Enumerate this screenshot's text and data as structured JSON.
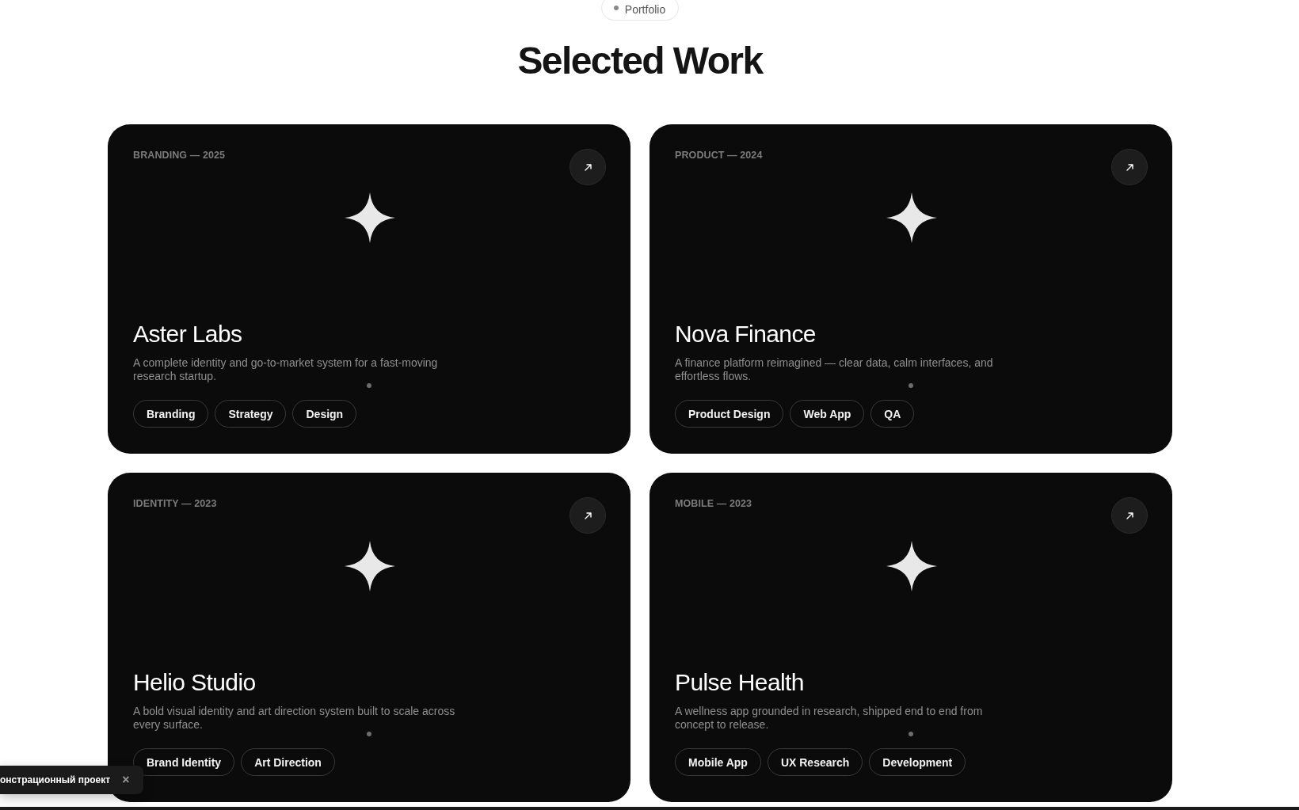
{
  "section": {
    "badge": "Portfolio",
    "title": "Selected Work"
  },
  "projects": [
    {
      "category": "BRANDING — 2025",
      "title": "Aster Labs",
      "description": "A complete identity and go-to-market system for a fast-moving research startup.",
      "tags": [
        "Branding",
        "Strategy",
        "Design"
      ]
    },
    {
      "category": "PRODUCT — 2024",
      "title": "Nova Finance",
      "description": "A finance platform reimagined — clear data, calm interfaces, and effortless flows.",
      "tags": [
        "Product Design",
        "Web App",
        "QA"
      ]
    },
    {
      "category": "IDENTITY — 2023",
      "title": "Helio Studio",
      "description": "A bold visual identity and art direction system built to scale across every surface.",
      "tags": [
        "Brand Identity",
        "Art Direction"
      ]
    },
    {
      "category": "MOBILE — 2023",
      "title": "Pulse Health",
      "description": "A wellness app grounded in research, shipped end to end from concept to release.",
      "tags": [
        "Mobile App",
        "UX Research",
        "Development"
      ]
    }
  ],
  "toast": {
    "text": "онстрационный проект",
    "close": "×"
  }
}
